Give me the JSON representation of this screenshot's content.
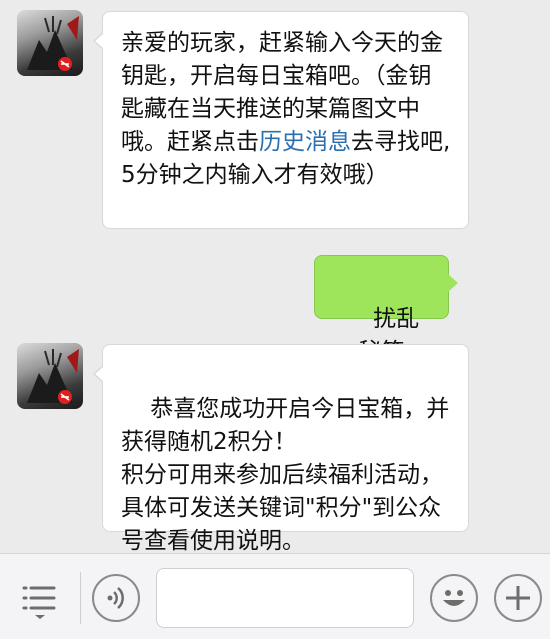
{
  "messages": [
    {
      "direction": "incoming",
      "sender_avatar": "game-avatar",
      "text_before_link": "亲爱的玩家，赶紧输入今天的金钥匙，开启每日宝箱吧。（金钥匙藏在当天推送的某篇图文中哦。赶紧点击",
      "link_text": "历史消息",
      "text_after_link": "去寻找吧,5分钟之内输入才有效哦）"
    },
    {
      "direction": "outgoing",
      "text": "扰乱秘策"
    },
    {
      "direction": "incoming",
      "sender_avatar": "game-avatar",
      "text": "恭喜您成功开启今日宝箱，并获得随机2积分！\n积分可用来参加后续福利活动，具体可发送关键词\"积分\"到公众号查看使用说明。"
    }
  ],
  "bottom_bar": {
    "icons": [
      "menu-list-icon",
      "voice-icon",
      "emoji-icon",
      "plus-icon"
    ],
    "input_value": ""
  },
  "colors": {
    "background": "#ebebeb",
    "incoming_bubble": "#ffffff",
    "outgoing_bubble": "#9ee55c",
    "link": "#2a6fb0"
  }
}
